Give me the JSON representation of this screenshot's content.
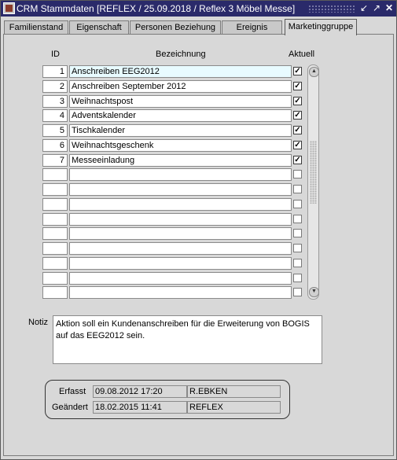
{
  "window": {
    "title": "CRM Stammdaten  [REFLEX / 25.09.2018 / Reflex 3 Möbel Messe]",
    "controls": [
      "minimize-icon",
      "maximize-icon",
      "close-icon"
    ]
  },
  "tabs": [
    {
      "label": "Familienstand",
      "active": false
    },
    {
      "label": "Eigenschaft",
      "active": false
    },
    {
      "label": "Personen Beziehung",
      "active": false
    },
    {
      "label": "Ereignis",
      "active": false
    },
    {
      "label": "Marketinggruppe",
      "active": true
    }
  ],
  "grid": {
    "headers": {
      "id": "ID",
      "bezeichnung": "Bezeichnung",
      "aktuell": "Aktuell"
    },
    "rows": [
      {
        "id": "1",
        "bezeichnung": "Anschreiben EEG2012",
        "aktuell": true
      },
      {
        "id": "2",
        "bezeichnung": "Anschreiben September 2012",
        "aktuell": true
      },
      {
        "id": "3",
        "bezeichnung": "Weihnachtspost",
        "aktuell": true
      },
      {
        "id": "4",
        "bezeichnung": "Adventskalender",
        "aktuell": true
      },
      {
        "id": "5",
        "bezeichnung": "Tischkalender",
        "aktuell": true
      },
      {
        "id": "6",
        "bezeichnung": "Weihnachtsgeschenk",
        "aktuell": true
      },
      {
        "id": "7",
        "bezeichnung": "Messeeinladung",
        "aktuell": true
      },
      {
        "id": "",
        "bezeichnung": "",
        "aktuell": false
      },
      {
        "id": "",
        "bezeichnung": "",
        "aktuell": false
      },
      {
        "id": "",
        "bezeichnung": "",
        "aktuell": false
      },
      {
        "id": "",
        "bezeichnung": "",
        "aktuell": false
      },
      {
        "id": "",
        "bezeichnung": "",
        "aktuell": false
      },
      {
        "id": "",
        "bezeichnung": "",
        "aktuell": false
      },
      {
        "id": "",
        "bezeichnung": "",
        "aktuell": false
      },
      {
        "id": "",
        "bezeichnung": "",
        "aktuell": false
      },
      {
        "id": "",
        "bezeichnung": "",
        "aktuell": false
      }
    ],
    "selected_row": 0
  },
  "notiz": {
    "label": "Notiz",
    "text": "Aktion soll ein Kundenanschreiben für die Erweiterung von BOGIS auf das EEG2012 sein."
  },
  "audit": {
    "erfasst_label": "Erfasst",
    "erfasst_date": "09.08.2012 17:20",
    "erfasst_user": "R.EBKEN",
    "geaendert_label": "Geändert",
    "geaendert_date": "18.02.2015 11:41",
    "geaendert_user": "REFLEX"
  },
  "colors": {
    "titlebar": "#2a2a6a",
    "window_bg": "#d8d8d8",
    "selected_cell": "#e8fbff"
  }
}
